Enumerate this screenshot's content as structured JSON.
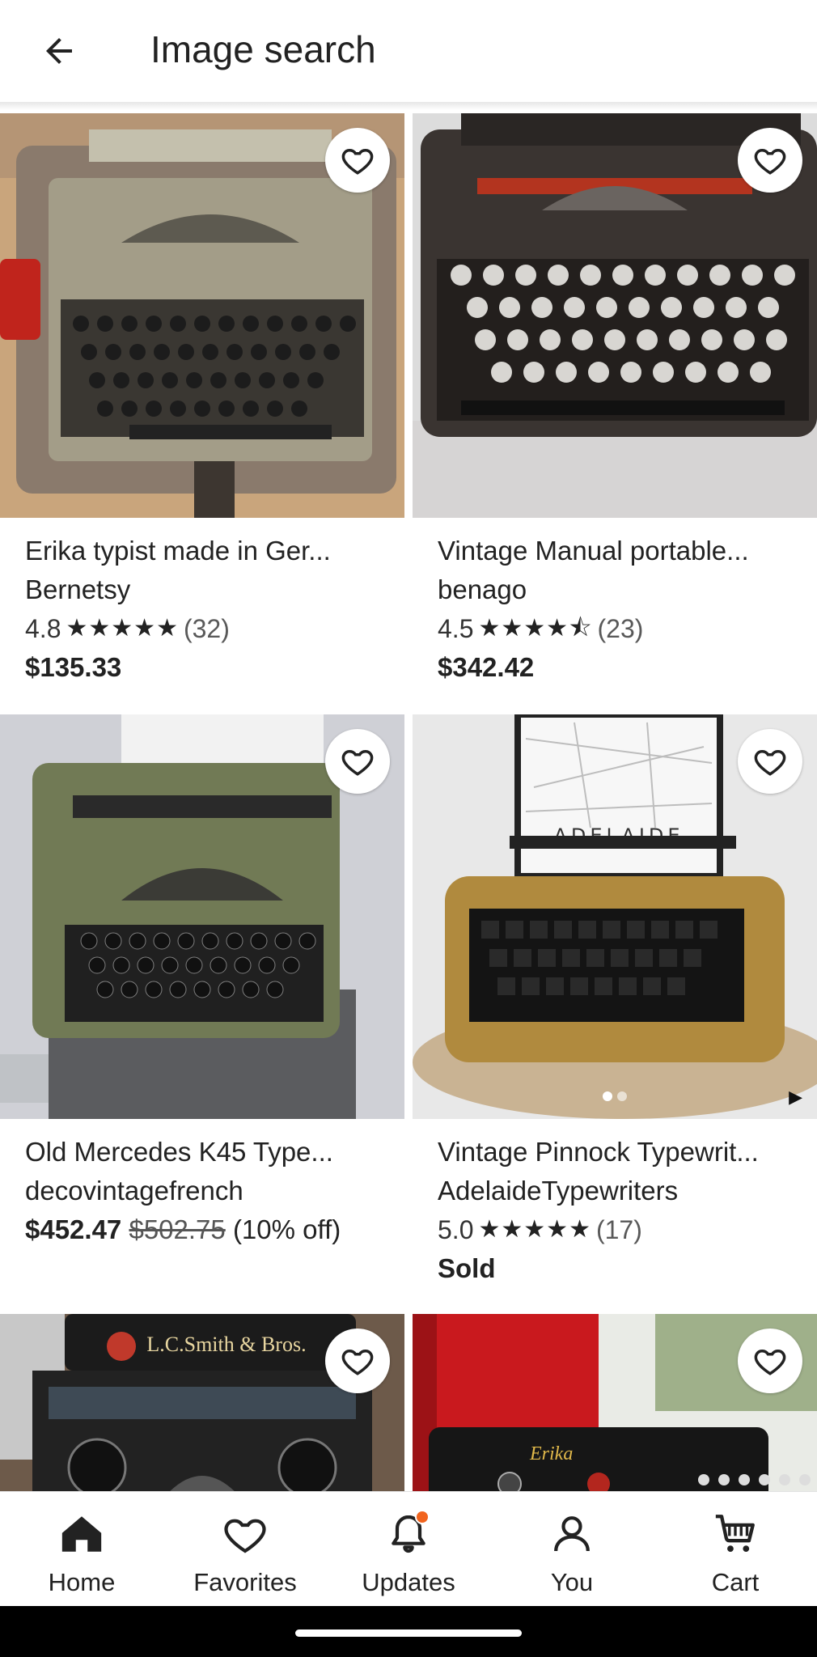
{
  "header": {
    "title": "Image search"
  },
  "listings": [
    {
      "title": "Erika typist made in Ger...",
      "shop": "Bernetsy",
      "rating": "4.8",
      "stars": "★★★★★",
      "reviews": "(32)",
      "price": "$135.33"
    },
    {
      "title": "Vintage Manual portable...",
      "shop": "benago",
      "rating": "4.5",
      "stars": "★★★★⯪",
      "reviews": "(23)",
      "price": "$342.42"
    },
    {
      "title": "Old Mercedes K45 Type...",
      "shop": "decovintagefrench",
      "price_now": "$452.47",
      "price_was": "$502.75",
      "discount": "(10% off)"
    },
    {
      "title": "Vintage Pinnock Typewrit...",
      "shop": "AdelaideTypewriters",
      "rating": "5.0",
      "stars": "★★★★★",
      "reviews": "(17)",
      "status": "Sold",
      "image_text": "ADELAIDE"
    },
    {
      "image_text": "L.C.Smith & Bros."
    },
    {
      "image_text": "Erika"
    }
  ],
  "nav": {
    "items": [
      {
        "label": "Home",
        "icon": "home-icon"
      },
      {
        "label": "Favorites",
        "icon": "heart-icon"
      },
      {
        "label": "Updates",
        "icon": "bell-icon"
      },
      {
        "label": "You",
        "icon": "person-icon"
      },
      {
        "label": "Cart",
        "icon": "cart-icon"
      }
    ]
  },
  "colors": {
    "accent": "#f1641e",
    "text": "#222222"
  }
}
